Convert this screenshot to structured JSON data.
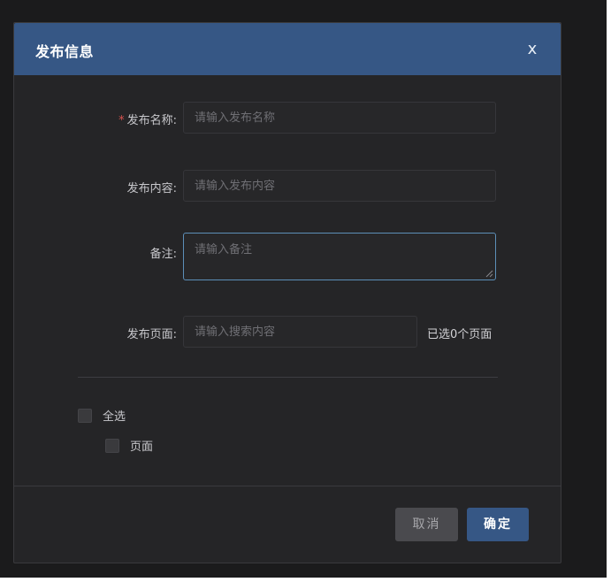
{
  "dialog": {
    "title": "发布信息",
    "close_glyph": "x"
  },
  "form": {
    "name": {
      "required": true,
      "label": "发布名称:",
      "placeholder": "请输入发布名称",
      "value": ""
    },
    "content": {
      "label": "发布内容:",
      "placeholder": "请输入发布内容",
      "value": ""
    },
    "remark": {
      "label": "备注:",
      "placeholder": "请输入备注",
      "value": ""
    },
    "pages": {
      "label": "发布页面:",
      "placeholder": "请输入搜索内容",
      "value": "",
      "selected_count_text": "已选0个页面"
    }
  },
  "checklist": {
    "select_all": {
      "label": "全选",
      "checked": false
    },
    "items": [
      {
        "label": "页面",
        "checked": false
      }
    ]
  },
  "footer": {
    "cancel_label": "取消",
    "ok_label": "确定"
  },
  "colors": {
    "header_bg": "#365785",
    "dialog_bg": "#252527",
    "backdrop": "#1b1b1c",
    "primary_button": "#365785",
    "cancel_button": "#4a4a4e",
    "required_star": "#d9534f",
    "focus_border": "#5c8fb8"
  }
}
